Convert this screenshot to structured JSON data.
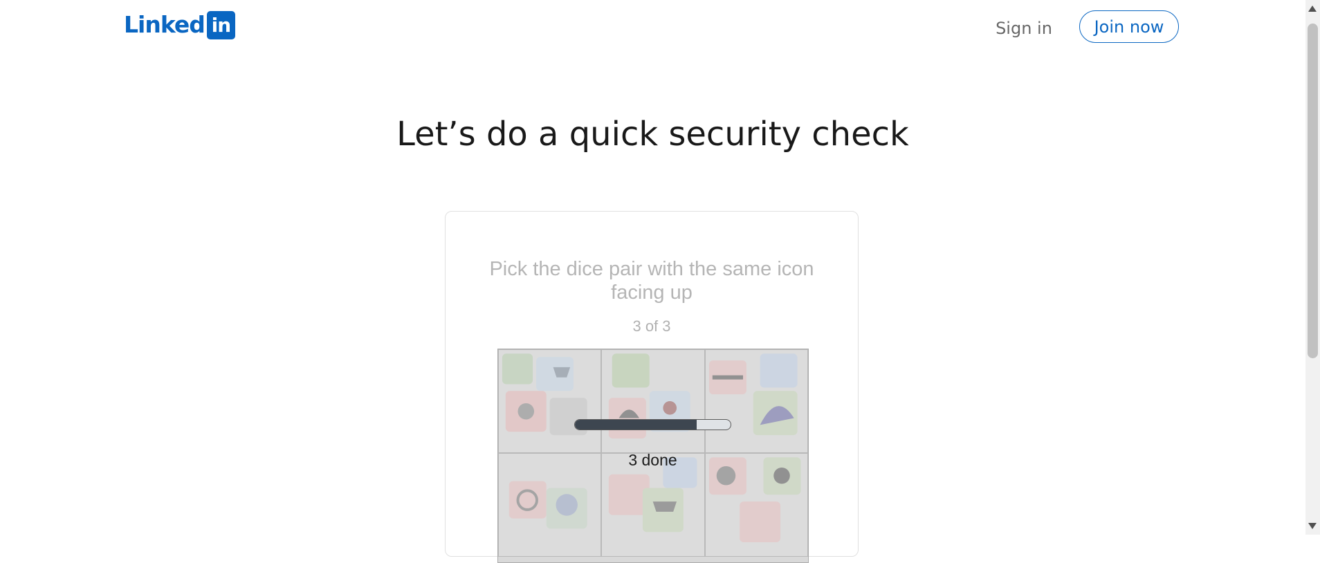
{
  "header": {
    "logo_word": "Linked",
    "logo_box": "in",
    "sign_in": "Sign in",
    "join_now": "Join now"
  },
  "page": {
    "title": "Let’s do a quick security check"
  },
  "challenge": {
    "instruction": "Pick the dice pair with the same icon facing up",
    "counter": "3 of 3",
    "progress_label": "3 done",
    "progress_fraction": 0.78,
    "tile_count": 6
  },
  "colors": {
    "brand": "#0a66c2",
    "progress_fill": "#3d4650"
  }
}
